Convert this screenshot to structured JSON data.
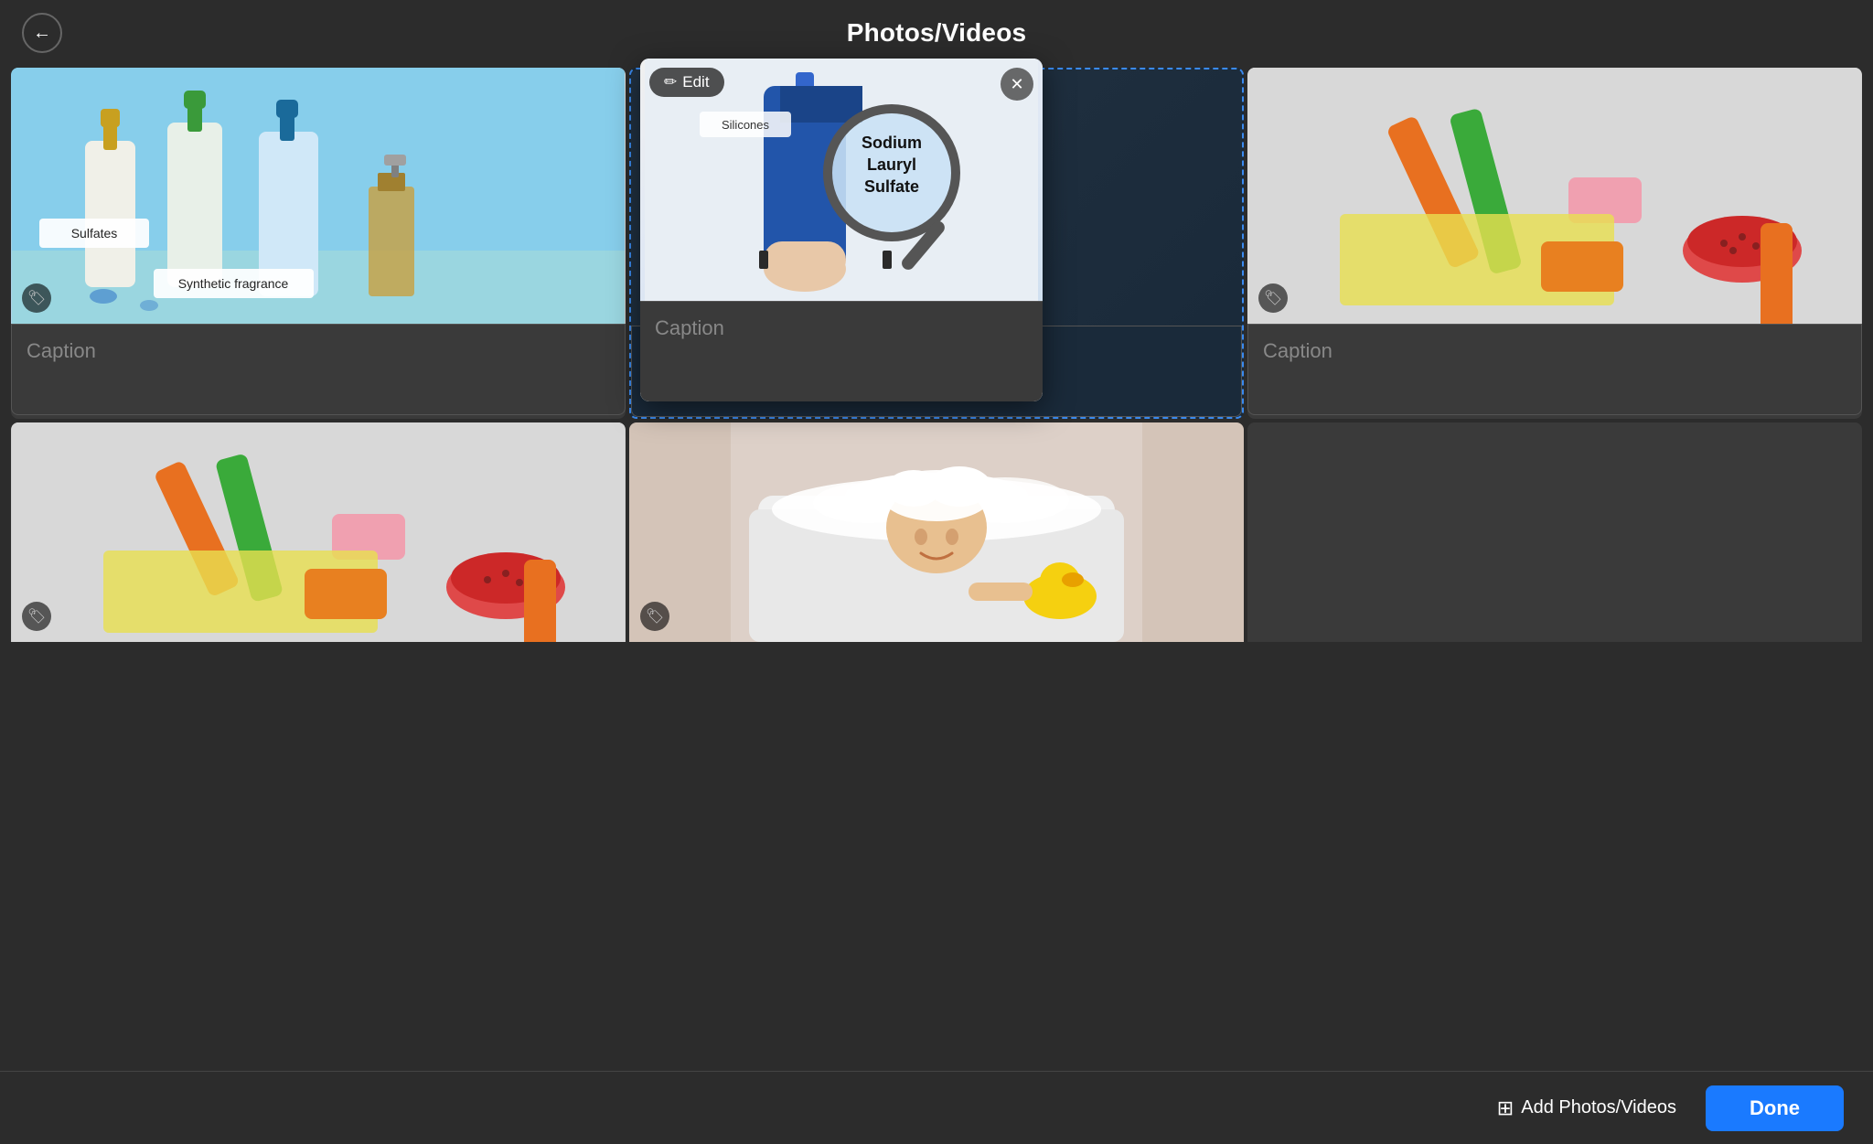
{
  "header": {
    "title": "Photos/Videos",
    "back_label": "←"
  },
  "grid": {
    "rows": [
      [
        {
          "id": "cell-1",
          "photo_type": "bottles",
          "caption": "Caption",
          "has_tag": true,
          "selected": false,
          "labels": [
            "Sulfates",
            "Synthetic fragrance"
          ]
        },
        {
          "id": "cell-2",
          "photo_type": "magnifier",
          "caption": "Caption",
          "has_tag": true,
          "selected": true,
          "edit_mode": true,
          "silicones_label": "Silicones",
          "magnifier_text": "Sodium\nLauryl\nSulfate"
        },
        {
          "id": "cell-3",
          "photo_type": "soap",
          "caption": "Caption",
          "has_tag": true,
          "selected": false
        }
      ],
      [
        {
          "id": "cell-4",
          "photo_type": "soap2",
          "caption": "",
          "has_tag": true,
          "selected": false
        },
        {
          "id": "cell-5",
          "photo_type": "bath",
          "caption": "",
          "has_tag": true,
          "selected": false
        },
        {
          "id": "cell-6",
          "photo_type": "empty",
          "caption": "",
          "has_tag": false,
          "selected": false
        }
      ]
    ]
  },
  "footer": {
    "add_label": "Add Photos/Videos",
    "done_label": "Done"
  },
  "icons": {
    "back": "←",
    "edit": "✏",
    "close": "✕",
    "tag": "🏷",
    "add": "⊞"
  }
}
